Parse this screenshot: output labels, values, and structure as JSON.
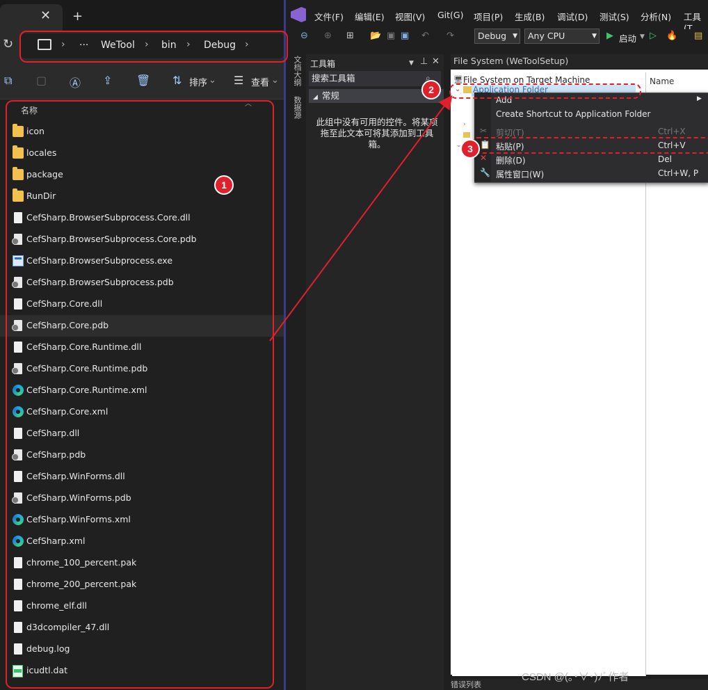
{
  "explorer": {
    "breadcrumb": [
      "WeTool",
      "bin",
      "Debug"
    ],
    "ellipsis": "···",
    "toolbar": {
      "sort_label": "排序",
      "view_label": "查看"
    },
    "column_header": "名称",
    "files": [
      {
        "name": "icon",
        "type": "folder"
      },
      {
        "name": "locales",
        "type": "folder"
      },
      {
        "name": "package",
        "type": "folder"
      },
      {
        "name": "RunDir",
        "type": "folder"
      },
      {
        "name": "CefSharp.BrowserSubprocess.Core.dll",
        "type": "dll"
      },
      {
        "name": "CefSharp.BrowserSubprocess.Core.pdb",
        "type": "pdb"
      },
      {
        "name": "CefSharp.BrowserSubprocess.exe",
        "type": "exe"
      },
      {
        "name": "CefSharp.BrowserSubprocess.pdb",
        "type": "pdb"
      },
      {
        "name": "CefSharp.Core.dll",
        "type": "dll"
      },
      {
        "name": "CefSharp.Core.pdb",
        "type": "pdb",
        "selected": true
      },
      {
        "name": "CefSharp.Core.Runtime.dll",
        "type": "dll"
      },
      {
        "name": "CefSharp.Core.Runtime.pdb",
        "type": "pdb"
      },
      {
        "name": "CefSharp.Core.Runtime.xml",
        "type": "xml"
      },
      {
        "name": "CefSharp.Core.xml",
        "type": "xml"
      },
      {
        "name": "CefSharp.dll",
        "type": "dll"
      },
      {
        "name": "CefSharp.pdb",
        "type": "pdb"
      },
      {
        "name": "CefSharp.WinForms.dll",
        "type": "dll"
      },
      {
        "name": "CefSharp.WinForms.pdb",
        "type": "pdb"
      },
      {
        "name": "CefSharp.WinForms.xml",
        "type": "xml"
      },
      {
        "name": "CefSharp.xml",
        "type": "xml"
      },
      {
        "name": "chrome_100_percent.pak",
        "type": "file"
      },
      {
        "name": "chrome_200_percent.pak",
        "type": "file"
      },
      {
        "name": "chrome_elf.dll",
        "type": "dll"
      },
      {
        "name": "d3dcompiler_47.dll",
        "type": "dll"
      },
      {
        "name": "debug.log",
        "type": "log"
      },
      {
        "name": "icudtl.dat",
        "type": "dat"
      }
    ]
  },
  "vs": {
    "menu": [
      "文件(F)",
      "编辑(E)",
      "视图(V)",
      "Git(G)",
      "项目(P)",
      "生成(B)",
      "调试(D)",
      "测试(S)",
      "分析(N)",
      "工具(T"
    ],
    "config": "Debug",
    "platform": "Any CPU",
    "start_label": "启动",
    "vertical_tabs": [
      "文档大纲",
      "数据源"
    ],
    "toolbox": {
      "title": "工具箱",
      "search_placeholder": "搜索工具箱",
      "group": "常规",
      "empty_message": "此组中没有可用的控件。将某项拖至此文本可将其添加到工具箱。"
    },
    "file_system": {
      "tab_title": "File System (WeToolSetup)",
      "root": "File System on Target Machine",
      "selected_node": "Application Folder",
      "name_column": "Name"
    },
    "context_menu": [
      {
        "label": "Add",
        "shortcut": "",
        "enabled": true,
        "submenu": true
      },
      {
        "label": "Create Shortcut to Application Folder",
        "shortcut": "",
        "enabled": true
      },
      {
        "label": "剪切(T)",
        "shortcut": "Ctrl+X",
        "enabled": false
      },
      {
        "label": "粘贴(P)",
        "shortcut": "Ctrl+V",
        "enabled": true
      },
      {
        "label": "删除(D)",
        "shortcut": "Del",
        "enabled": true
      },
      {
        "label": "属性窗口(W)",
        "shortcut": "Ctrl+W, P",
        "enabled": true
      }
    ],
    "bottom_label": "错误列表"
  },
  "annotations": {
    "badge1": "1",
    "badge2": "2",
    "badge3": "3"
  },
  "watermark": "CSDN @(｡･∀･)ﾉﾞ作者"
}
